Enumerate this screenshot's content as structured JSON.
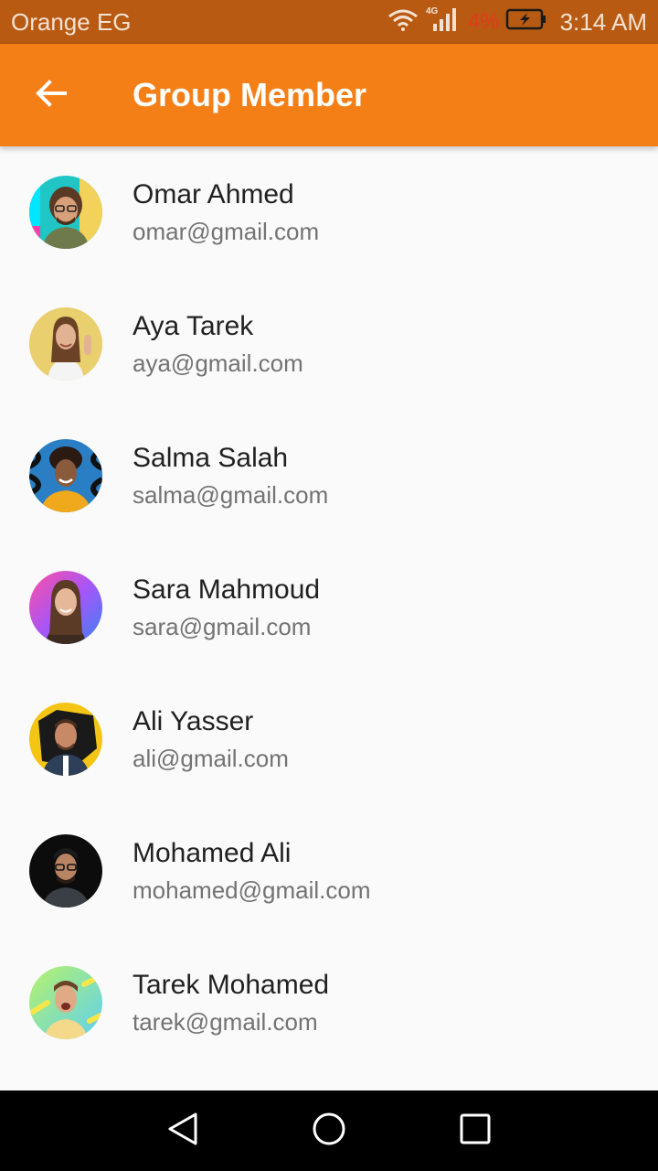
{
  "status_bar": {
    "carrier": "Orange EG",
    "network": "4G",
    "battery_percent": "4%",
    "time": "3:14 AM"
  },
  "app_bar": {
    "title": "Group Member",
    "back_icon": "arrow-back-icon",
    "background": "#f57f17"
  },
  "members": [
    {
      "name": "Omar Ahmed",
      "email": "omar@gmail.com"
    },
    {
      "name": "Aya Tarek",
      "email": "aya@gmail.com"
    },
    {
      "name": "Salma Salah",
      "email": "salma@gmail.com"
    },
    {
      "name": "Sara Mahmoud",
      "email": "sara@gmail.com"
    },
    {
      "name": "Ali Yasser",
      "email": "ali@gmail.com"
    },
    {
      "name": "Mohamed Ali",
      "email": "mohamed@gmail.com"
    },
    {
      "name": "Tarek Mohamed",
      "email": "tarek@gmail.com"
    }
  ],
  "nav_bar": {
    "back_icon": "nav-back-triangle-icon",
    "home_icon": "nav-home-circle-icon",
    "recents_icon": "nav-recents-square-icon"
  }
}
